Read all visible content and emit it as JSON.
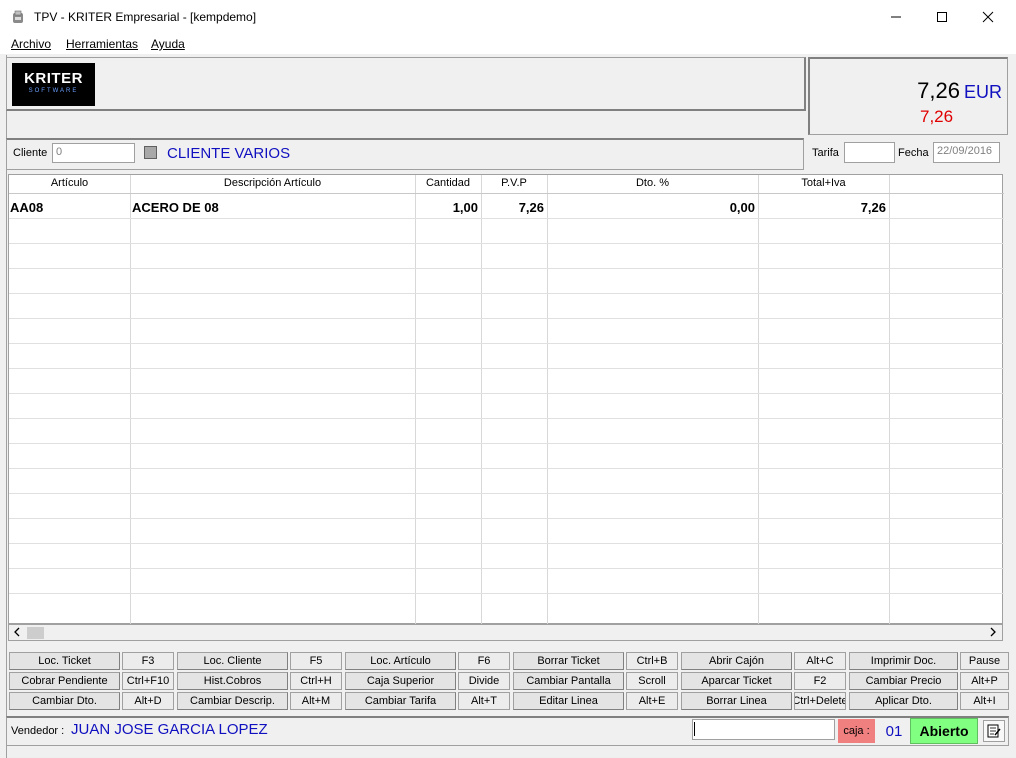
{
  "window": {
    "title": "TPV - KRITER Empresarial -  [kempdemo]",
    "minimize": "—",
    "maximize": "☐",
    "close": "✕"
  },
  "menu": [
    "Archivo",
    "Herramientas",
    "Ayuda"
  ],
  "logo": {
    "name": "KRITER",
    "tagline": "SOFTWARE"
  },
  "totals": {
    "amount": "7,26",
    "currency": "EUR",
    "subtotal": "7,26"
  },
  "client": {
    "label": "Cliente",
    "code": "0",
    "name": "CLIENTE VARIOS",
    "tarifa_label": "Tarifa",
    "tarifa_value": "",
    "fecha_label": "Fecha",
    "fecha_value": "22/09/2016"
  },
  "grid": {
    "columns": [
      "Artículo",
      "Descripción Artículo",
      "Cantidad",
      "P.V.P",
      "Dto. %",
      "Total+Iva"
    ],
    "rows": [
      {
        "articulo": "AA08",
        "descripcion": "ACERO DE 08",
        "cantidad": "1,00",
        "pvp": "7,26",
        "dto": "0,00",
        "total": "7,26"
      }
    ]
  },
  "buttons": [
    [
      {
        "label": "Loc. Ticket",
        "key": "F3"
      },
      {
        "label": "Loc. Cliente",
        "key": "F5"
      },
      {
        "label": "Loc. Artículo",
        "key": "F6"
      },
      {
        "label": "Borrar Ticket",
        "key": "Ctrl+B"
      },
      {
        "label": "Abrir Cajón",
        "key": "Alt+C"
      },
      {
        "label": "Imprimir Doc.",
        "key": "Pause"
      }
    ],
    [
      {
        "label": "Cobrar Pendiente",
        "key": "Ctrl+F10"
      },
      {
        "label": "Hist.Cobros",
        "key": "Ctrl+H"
      },
      {
        "label": "Caja Superior",
        "key": "Divide"
      },
      {
        "label": "Cambiar Pantalla",
        "key": "Scroll"
      },
      {
        "label": "Aparcar Ticket",
        "key": "F2"
      },
      {
        "label": "Cambiar Precio",
        "key": "Alt+P"
      }
    ],
    [
      {
        "label": "Cambiar Dto.",
        "key": "Alt+D"
      },
      {
        "label": "Cambiar Descrip.",
        "key": "Alt+M"
      },
      {
        "label": "Cambiar Tarifa",
        "key": "Alt+T"
      },
      {
        "label": "Editar Linea",
        "key": "Alt+E"
      },
      {
        "label": "Borrar Linea",
        "key": "Ctrl+Delete"
      },
      {
        "label": "Aplicar Dto.",
        "key": "Alt+I"
      }
    ]
  ],
  "status": {
    "vendedor_label": "Vendedor :",
    "vendedor_name": "JUAN JOSE GARCIA LOPEZ",
    "input_value": "",
    "caja_label": "caja :",
    "caja_number": "01",
    "state": "Abierto"
  },
  "colors": {
    "accent_blue": "#1010c0",
    "red": "#e00000",
    "caja_bg": "#f08080",
    "open_bg": "#80ff80"
  },
  "icons": [
    "app-icon",
    "notepad-icon"
  ]
}
